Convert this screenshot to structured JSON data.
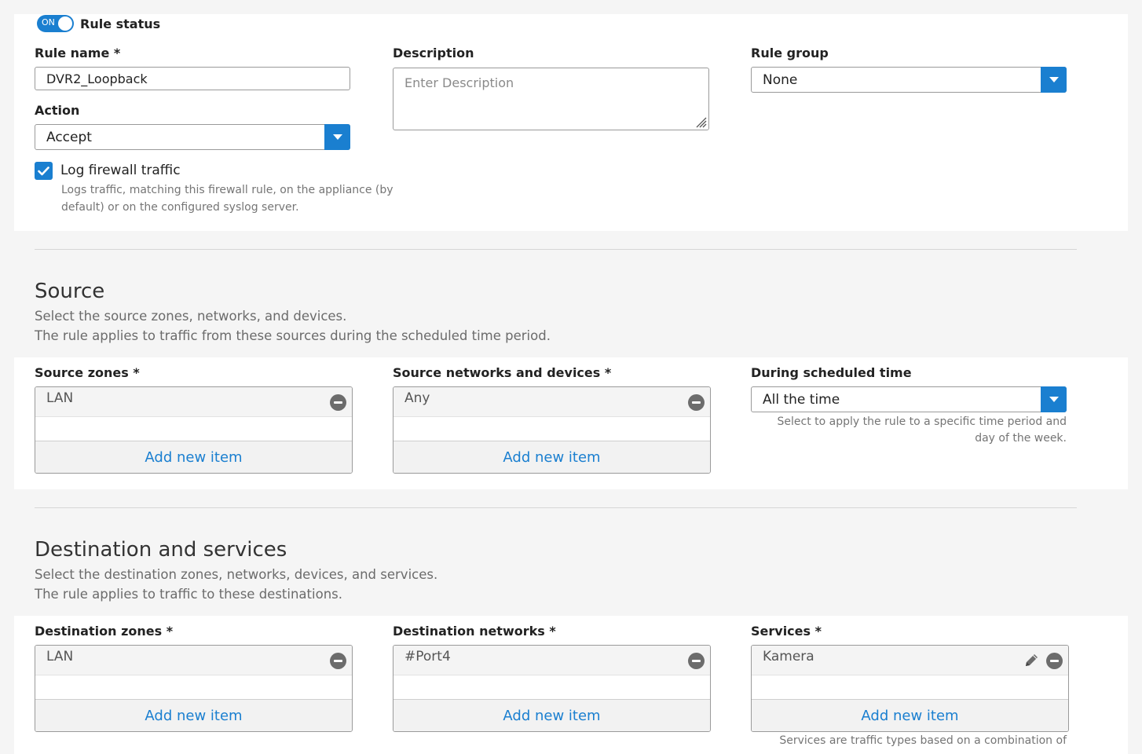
{
  "rule": {
    "status_label": "Rule status",
    "toggle_text": "ON",
    "name_label": "Rule name *",
    "name_value": "DVR2_Loopback",
    "description_label": "Description",
    "description_placeholder": "Enter Description",
    "group_label": "Rule group",
    "group_value": "None",
    "action_label": "Action",
    "action_value": "Accept",
    "log_label": "Log firewall traffic",
    "log_help_1": "Logs traffic, matching this firewall rule, on the appliance (by",
    "log_help_2": "default) or on the configured syslog server."
  },
  "source": {
    "title": "Source",
    "desc_1": "Select the source zones, networks, and devices.",
    "desc_2": "The rule applies to traffic from these sources during the scheduled time period.",
    "zones_label": "Source zones *",
    "zones_item": "LAN",
    "networks_label": "Source networks and devices *",
    "networks_item": "Any",
    "schedule_label": "During scheduled time",
    "schedule_value": "All the time",
    "schedule_help_1": "Select to apply the rule to a specific time period and",
    "schedule_help_2": "day of the week.",
    "add_item": "Add new item"
  },
  "destination": {
    "title": "Destination and services",
    "desc_1": "Select the destination zones, networks, devices, and services.",
    "desc_2": "The rule applies to traffic to these destinations.",
    "zones_label": "Destination zones *",
    "zones_item": "LAN",
    "networks_label": "Destination networks *",
    "networks_item": "#Port4",
    "services_label": "Services *",
    "services_item": "Kamera",
    "services_help": "Services are traffic types based on a combination of",
    "add_item": "Add new item"
  },
  "colors": {
    "accent": "#1a7fd0",
    "background": "#f5f5f5",
    "panel": "#ffffff"
  },
  "icons": [
    "toggle-switch",
    "check-icon",
    "dropdown-arrow-icon",
    "remove-icon",
    "edit-pencil-icon",
    "resize-grip-icon"
  ]
}
